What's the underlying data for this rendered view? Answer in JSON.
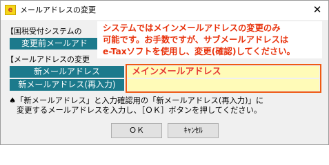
{
  "window": {
    "title": "メールアドレスの変更",
    "close_glyph": "✕"
  },
  "section1": {
    "heading": "【国税受付システムの",
    "current_label": "変更前メールアド",
    "current_value": ""
  },
  "section2": {
    "heading": "【メールアドレスの変更",
    "new_label": "新メールアドレス",
    "new_value": "メインメールアドレス",
    "confirm_label": "新メールアドレス(再入力)",
    "confirm_value": ""
  },
  "callout": {
    "line1": "システムではメインメールアドレスの変更のみ",
    "line2": "可能です。お手数ですが、サブメールアドレスは",
    "line3": "e-Taxソフトを使用し、変更(確認)してください。"
  },
  "instructions": {
    "line1": "♠「新メールアドレス」と入力確認用の「新メールアドレス(再入力)」に",
    "line2": "変更するメールアドレスを入力し、［ＯＫ］ボタンを押してください。"
  },
  "buttons": {
    "ok": "ＯＫ",
    "cancel": "ｷｬﾝｾﾙ"
  },
  "colors": {
    "label_bg": "#1c7a8c",
    "input_bg": "#fffbb8",
    "accent_red": "#e8320c",
    "frame_orange": "#ef5a13"
  },
  "icons": {
    "app": "etax-app-icon",
    "close": "close-icon"
  }
}
